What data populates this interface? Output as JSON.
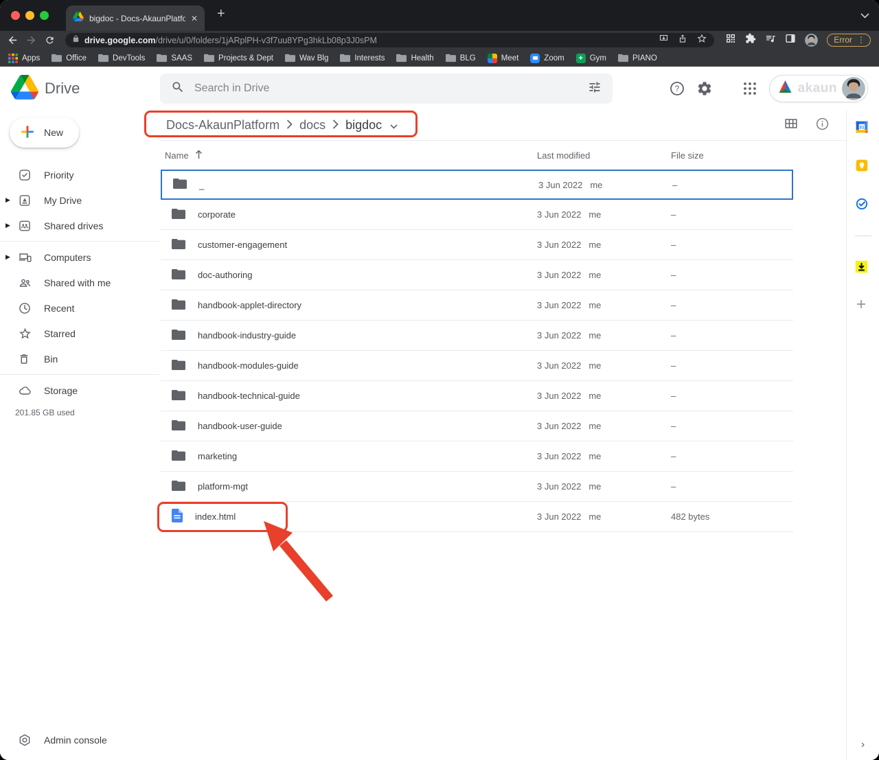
{
  "browser": {
    "tab_title": "bigdoc - Docs-AkaunPlatform",
    "new_tab_label": "+",
    "tab_close_label": "✕",
    "url_domain": "drive.google.com",
    "url_path": "/drive/u/0/folders/1jARplPH-v3f7uu8YPg3hkLb08p3J0sPM",
    "error_badge": "Error",
    "bookmarks": [
      {
        "label": "Apps",
        "icon": "apps-color"
      },
      {
        "label": "Office",
        "icon": "folder-bm"
      },
      {
        "label": "DevTools",
        "icon": "folder-bm"
      },
      {
        "label": "SAAS",
        "icon": "folder-bm"
      },
      {
        "label": "Projects & Dept",
        "icon": "folder-bm"
      },
      {
        "label": "Wav Blg",
        "icon": "folder-bm"
      },
      {
        "label": "Interests",
        "icon": "folder-bm"
      },
      {
        "label": "Health",
        "icon": "folder-bm"
      },
      {
        "label": "BLG",
        "icon": "folder-bm"
      },
      {
        "label": "Meet",
        "icon": "meet"
      },
      {
        "label": "Zoom",
        "icon": "zoomapp"
      },
      {
        "label": "Gym",
        "icon": "gym"
      },
      {
        "label": "PIANO",
        "icon": "folder-bm"
      }
    ]
  },
  "drive_header": {
    "app_name": "Drive",
    "search_placeholder": "Search in Drive",
    "brand_badge": "akaun"
  },
  "breadcrumb": {
    "items": [
      "Docs-AkaunPlatform",
      "docs",
      "bigdoc"
    ]
  },
  "sidebar": {
    "new_button": "New",
    "items": [
      {
        "label": "Priority",
        "icon": "priority",
        "expandable": false,
        "divider_after": false
      },
      {
        "label": "My Drive",
        "icon": "mydrive",
        "expandable": true,
        "divider_after": false
      },
      {
        "label": "Shared drives",
        "icon": "shareddrives",
        "expandable": true,
        "divider_after": true
      },
      {
        "label": "Computers",
        "icon": "computers",
        "expandable": true,
        "divider_after": false
      },
      {
        "label": "Shared with me",
        "icon": "sharedwithme",
        "expandable": false,
        "divider_after": false
      },
      {
        "label": "Recent",
        "icon": "recent",
        "expandable": false,
        "divider_after": false
      },
      {
        "label": "Starred",
        "icon": "starred",
        "expandable": false,
        "divider_after": false
      },
      {
        "label": "Bin",
        "icon": "bin",
        "expandable": false,
        "divider_after": true
      }
    ],
    "storage_label": "Storage",
    "storage_used": "201.85 GB used",
    "admin_console": "Admin console"
  },
  "file_table": {
    "columns": {
      "name": "Name",
      "modified": "Last modified",
      "size": "File size"
    },
    "rows": [
      {
        "name": "_",
        "type": "folder",
        "modified": "3 Jun 2022",
        "owner": "me",
        "size": "–",
        "selected": true
      },
      {
        "name": "corporate",
        "type": "folder",
        "modified": "3 Jun 2022",
        "owner": "me",
        "size": "–"
      },
      {
        "name": "customer-engagement",
        "type": "folder",
        "modified": "3 Jun 2022",
        "owner": "me",
        "size": "–"
      },
      {
        "name": "doc-authoring",
        "type": "folder",
        "modified": "3 Jun 2022",
        "owner": "me",
        "size": "–"
      },
      {
        "name": "handbook-applet-directory",
        "type": "folder",
        "modified": "3 Jun 2022",
        "owner": "me",
        "size": "–"
      },
      {
        "name": "handbook-industry-guide",
        "type": "folder",
        "modified": "3 Jun 2022",
        "owner": "me",
        "size": "–"
      },
      {
        "name": "handbook-modules-guide",
        "type": "folder",
        "modified": "3 Jun 2022",
        "owner": "me",
        "size": "–"
      },
      {
        "name": "handbook-technical-guide",
        "type": "folder",
        "modified": "3 Jun 2022",
        "owner": "me",
        "size": "–"
      },
      {
        "name": "handbook-user-guide",
        "type": "folder",
        "modified": "3 Jun 2022",
        "owner": "me",
        "size": "–"
      },
      {
        "name": "marketing",
        "type": "folder",
        "modified": "3 Jun 2022",
        "owner": "me",
        "size": "–"
      },
      {
        "name": "platform-mgt",
        "type": "folder",
        "modified": "3 Jun 2022",
        "owner": "me",
        "size": "–"
      },
      {
        "name": "index.html",
        "type": "file",
        "modified": "3 Jun 2022",
        "owner": "me",
        "size": "482 bytes"
      }
    ]
  },
  "right_rail": {
    "items": [
      "calendar",
      "keep",
      "tasks",
      "divider",
      "download",
      "add"
    ],
    "collapse_chevron": "›"
  },
  "colors": {
    "annotation_red": "#e8402a",
    "selected_row_blue": "#2e75c6",
    "folder_gray": "#5f6368",
    "file_blue": "#4285f4",
    "error_gold": "#dfb661"
  }
}
